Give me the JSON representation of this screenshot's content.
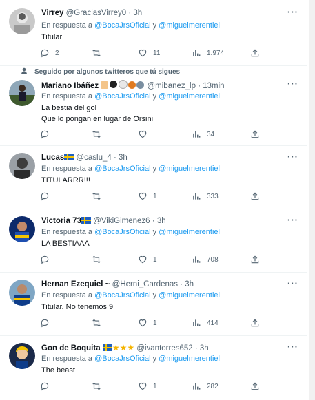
{
  "more_label": "···",
  "reply_prefix": "En respuesta a",
  "reply_mention_1": "@BocaJrsOficial",
  "reply_join": "y",
  "reply_mention_2": "@miguelmerentiel",
  "social_context": "Seguido por algunos twitteros que tú sigues",
  "tweets": [
    {
      "name": "Virrey",
      "handle": "@GraciasVirrey0",
      "time": "· 3h",
      "text": [
        "Titular"
      ],
      "replies": "2",
      "retweets": "",
      "likes": "11",
      "views": "1.974"
    },
    {
      "name": "Mariano Ibáñez",
      "handle": "@mibanez_lp",
      "time": "· 13min",
      "text": [
        "La bestia del gol",
        "Que lo pongan en lugar de Orsini"
      ],
      "replies": "",
      "retweets": "",
      "likes": "",
      "views": "34"
    },
    {
      "name": "Lucas",
      "handle": "@caslu_4",
      "time": "· 3h",
      "text": [
        "TITULARRR!!!"
      ],
      "replies": "",
      "retweets": "",
      "likes": "1",
      "views": "333"
    },
    {
      "name": "Victoria 73",
      "handle": "@VikiGimenez6",
      "time": "· 3h",
      "text": [
        "LA BESTIAAA"
      ],
      "replies": "",
      "retweets": "",
      "likes": "1",
      "views": "708"
    },
    {
      "name": "Hernan Ezequiel ~",
      "handle": "@Herni_Cardenas",
      "time": "· 3h",
      "text": [
        "Titular. No tenemos 9"
      ],
      "replies": "",
      "retweets": "",
      "likes": "1",
      "views": "414"
    },
    {
      "name": "Gon de Boquita",
      "handle": "@ivantorres652",
      "time": "· 3h",
      "text": [
        "The beast"
      ],
      "replies": "",
      "retweets": "",
      "likes": "1",
      "views": "282"
    }
  ],
  "colors": {
    "accent": "#1d9bf0",
    "muted": "#536471",
    "text": "#0f1419",
    "divider": "#eff3f4"
  }
}
